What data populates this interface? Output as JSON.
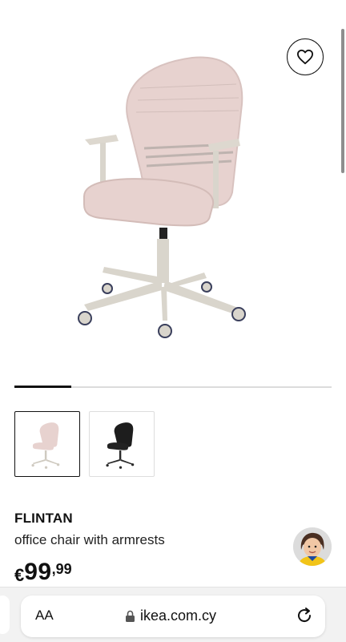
{
  "product": {
    "name": "FLINTAN",
    "description": "office chair with armrests",
    "price_currency": "€",
    "price_integer": "99",
    "price_decimal": ",99"
  },
  "gallery": {
    "progress": 0.18,
    "thumbnails": [
      {
        "name": "beige office chair",
        "selected": true
      },
      {
        "name": "black office chair",
        "selected": false
      }
    ]
  },
  "browser": {
    "text_size_label": "AA",
    "url": "ikea.com.cy"
  },
  "colors": {
    "chair_beige": "#e7d2cf",
    "chair_frame": "#d9d5cc",
    "text_primary": "#111111"
  },
  "icons": [
    "heart-icon",
    "lock-icon",
    "reload-icon"
  ]
}
